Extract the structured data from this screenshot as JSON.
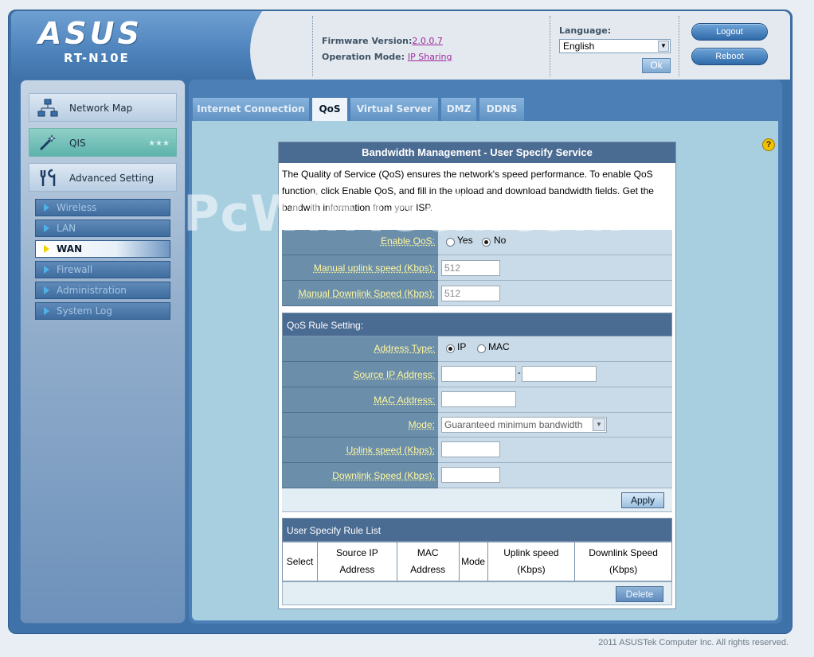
{
  "header": {
    "logo_text": "ASUS",
    "model": "RT-N10E",
    "firmware_label": "Firmware Version:",
    "firmware_value": "2.0.0.7",
    "opmode_label": "Operation Mode:",
    "opmode_value": "IP Sharing",
    "language_label": "Language:",
    "language_value": "English",
    "ok_label": "Ok",
    "logout_label": "Logout",
    "reboot_label": "Reboot"
  },
  "sidebar": {
    "main_items": [
      {
        "label": "Network Map",
        "icon": "network-map-icon"
      },
      {
        "label": "QIS",
        "icon": "magic-wand-icon"
      },
      {
        "label": "Advanced Setting",
        "icon": "tools-icon"
      }
    ],
    "sub_items": [
      {
        "label": "Wireless"
      },
      {
        "label": "LAN"
      },
      {
        "label": "WAN",
        "active": true
      },
      {
        "label": "Firewall"
      },
      {
        "label": "Administration"
      },
      {
        "label": "System Log"
      }
    ]
  },
  "tabs": [
    {
      "label": "Internet Connection"
    },
    {
      "label": "QoS",
      "active": true
    },
    {
      "label": "Virtual Server"
    },
    {
      "label": "DMZ"
    },
    {
      "label": "DDNS"
    }
  ],
  "panel": {
    "title": "Bandwidth Management - User Specify Service",
    "description": "The Quality of Service (QoS) ensures the network's speed performance. To enable QoS function, click Enable QoS, and fill in the upload and download bandwidth fields. Get the bandwith information from your ISP.",
    "enable_qos_label": "Enable QoS:",
    "yes_label": "Yes",
    "no_label": "No",
    "uplink_label": "Manual uplink speed (Kbps):",
    "uplink_value": "512",
    "downlink_label": "Manual Downlink Speed (Kbps):",
    "downlink_value": "512",
    "rule_section": "QoS Rule Setting:",
    "address_type_label": "Address Type:",
    "ip_label": "IP",
    "mac_label": "MAC",
    "source_ip_label": "Source IP Address:",
    "mac_address_label": "MAC Address:",
    "mode_label": "Mode:",
    "mode_value": "Guaranteed minimum bandwidth",
    "rule_uplink_label": "Uplink speed (Kbps):",
    "rule_downlink_label": "Downlink Speed (Kbps):",
    "apply_label": "Apply",
    "list_section": "User Specify Rule List",
    "columns": [
      "Select",
      "Source IP Address",
      "MAC Address",
      "Mode",
      "Uplink speed (Kbps)",
      "Downlink Speed (Kbps)"
    ],
    "delete_label": "Delete"
  },
  "watermark": "PcWinTech.com",
  "footer": "2011 ASUSTek Computer Inc. All rights reserved."
}
